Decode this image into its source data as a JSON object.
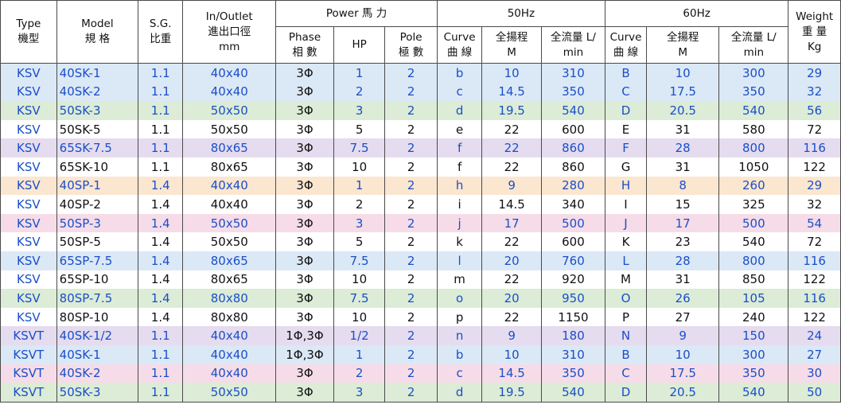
{
  "headers": {
    "type": [
      "Type",
      "機型"
    ],
    "model": [
      "Model",
      "規 格"
    ],
    "sg": [
      "S.G.",
      "比重"
    ],
    "inout": [
      "In/Outlet",
      "進出口徑",
      "mm"
    ],
    "power": "Power 馬 力",
    "hz50": "50Hz",
    "hz60": "60Hz",
    "weight": [
      "Weight",
      "重 量",
      "Kg"
    ],
    "phase": [
      "Phase",
      "相 數"
    ],
    "hp": "HP",
    "pole": [
      "Pole",
      "極 數"
    ],
    "curve": [
      "Curve",
      "曲 線"
    ],
    "head": [
      "全揚程",
      "M"
    ],
    "flow": [
      "全流量 L/",
      "min"
    ]
  },
  "rows": [
    {
      "type": "KSV",
      "model": "40SK-1",
      "sg": "1.1",
      "inout": "40x40",
      "phase": "3Φ",
      "hp": "1",
      "pole": "2",
      "c50": "b",
      "m50": "10",
      "f50": "310",
      "c60": "B",
      "m60": "10",
      "f60": "300",
      "kg": "29",
      "tint": "blue"
    },
    {
      "type": "KSV",
      "model": "40SK-2",
      "sg": "1.1",
      "inout": "40x40",
      "phase": "3Φ",
      "hp": "2",
      "pole": "2",
      "c50": "c",
      "m50": "14.5",
      "f50": "350",
      "c60": "C",
      "m60": "17.5",
      "f60": "350",
      "kg": "32",
      "tint": "blue"
    },
    {
      "type": "KSV",
      "model": "50SK-3",
      "sg": "1.1",
      "inout": "50x50",
      "phase": "3Φ",
      "hp": "3",
      "pole": "2",
      "c50": "d",
      "m50": "19.5",
      "f50": "540",
      "c60": "D",
      "m60": "20.5",
      "f60": "540",
      "kg": "56",
      "tint": "green"
    },
    {
      "type": "KSV",
      "model": "50SK-5",
      "sg": "1.1",
      "inout": "50x50",
      "phase": "3Φ",
      "hp": "5",
      "pole": "2",
      "c50": "e",
      "m50": "22",
      "f50": "600",
      "c60": "E",
      "m60": "31",
      "f60": "580",
      "kg": "72",
      "tint": "white"
    },
    {
      "type": "KSV",
      "model": "65SK-7.5",
      "sg": "1.1",
      "inout": "80x65",
      "phase": "3Φ",
      "hp": "7.5",
      "pole": "2",
      "c50": "f",
      "m50": "22",
      "f50": "860",
      "c60": "F",
      "m60": "28",
      "f60": "800",
      "kg": "116",
      "tint": "purple"
    },
    {
      "type": "KSV",
      "model": "65SK-10",
      "sg": "1.1",
      "inout": "80x65",
      "phase": "3Φ",
      "hp": "10",
      "pole": "2",
      "c50": "f",
      "m50": "22",
      "f50": "860",
      "c60": "G",
      "m60": "31",
      "f60": "1050",
      "kg": "122",
      "tint": "white"
    },
    {
      "type": "KSV",
      "model": "40SP-1",
      "sg": "1.4",
      "inout": "40x40",
      "phase": "3Φ",
      "hp": "1",
      "pole": "2",
      "c50": "h",
      "m50": "9",
      "f50": "280",
      "c60": "H",
      "m60": "8",
      "f60": "260",
      "kg": "29",
      "tint": "orange"
    },
    {
      "type": "KSV",
      "model": "40SP-2",
      "sg": "1.4",
      "inout": "40x40",
      "phase": "3Φ",
      "hp": "2",
      "pole": "2",
      "c50": "i",
      "m50": "14.5",
      "f50": "340",
      "c60": "I",
      "m60": "15",
      "f60": "325",
      "kg": "32",
      "tint": "white"
    },
    {
      "type": "KSV",
      "model": "50SP-3",
      "sg": "1.4",
      "inout": "50x50",
      "phase": "3Φ",
      "hp": "3",
      "pole": "2",
      "c50": "j",
      "m50": "17",
      "f50": "500",
      "c60": "J",
      "m60": "17",
      "f60": "500",
      "kg": "54",
      "tint": "pink"
    },
    {
      "type": "KSV",
      "model": "50SP-5",
      "sg": "1.4",
      "inout": "50x50",
      "phase": "3Φ",
      "hp": "5",
      "pole": "2",
      "c50": "k",
      "m50": "22",
      "f50": "600",
      "c60": "K",
      "m60": "23",
      "f60": "540",
      "kg": "72",
      "tint": "white"
    },
    {
      "type": "KSV",
      "model": "65SP-7.5",
      "sg": "1.4",
      "inout": "80x65",
      "phase": "3Φ",
      "hp": "7.5",
      "pole": "2",
      "c50": "l",
      "m50": "20",
      "f50": "760",
      "c60": "L",
      "m60": "28",
      "f60": "800",
      "kg": "116",
      "tint": "blue"
    },
    {
      "type": "KSV",
      "model": "65SP-10",
      "sg": "1.4",
      "inout": "80x65",
      "phase": "3Φ",
      "hp": "10",
      "pole": "2",
      "c50": "m",
      "m50": "22",
      "f50": "920",
      "c60": "M",
      "m60": "31",
      "f60": "850",
      "kg": "122",
      "tint": "white"
    },
    {
      "type": "KSV",
      "model": "80SP-7.5",
      "sg": "1.4",
      "inout": "80x80",
      "phase": "3Φ",
      "hp": "7.5",
      "pole": "2",
      "c50": "o",
      "m50": "20",
      "f50": "950",
      "c60": "O",
      "m60": "26",
      "f60": "105",
      "kg": "116",
      "tint": "green"
    },
    {
      "type": "KSV",
      "model": "80SP-10",
      "sg": "1.4",
      "inout": "80x80",
      "phase": "3Φ",
      "hp": "10",
      "pole": "2",
      "c50": "p",
      "m50": "22",
      "f50": "1150",
      "c60": "P",
      "m60": "27",
      "f60": "240",
      "kg": "122",
      "tint": "white"
    },
    {
      "type": "KSVT",
      "model": "40SK-1/2",
      "sg": "1.1",
      "inout": "40x40",
      "phase": "1Φ,3Φ",
      "hp": "1/2",
      "pole": "2",
      "c50": "n",
      "m50": "9",
      "f50": "180",
      "c60": "N",
      "m60": "9",
      "f60": "150",
      "kg": "24",
      "tint": "purple"
    },
    {
      "type": "KSVT",
      "model": "40SK-1",
      "sg": "1.1",
      "inout": "40x40",
      "phase": "1Φ,3Φ",
      "hp": "1",
      "pole": "2",
      "c50": "b",
      "m50": "10",
      "f50": "310",
      "c60": "B",
      "m60": "10",
      "f60": "300",
      "kg": "27",
      "tint": "blue"
    },
    {
      "type": "KSVT",
      "model": "40SK-2",
      "sg": "1.1",
      "inout": "40x40",
      "phase": "3Φ",
      "hp": "2",
      "pole": "2",
      "c50": "c",
      "m50": "14.5",
      "f50": "350",
      "c60": "C",
      "m60": "17.5",
      "f60": "350",
      "kg": "30",
      "tint": "pink"
    },
    {
      "type": "KSVT",
      "model": "50SK-3",
      "sg": "1.1",
      "inout": "50x50",
      "phase": "3Φ",
      "hp": "3",
      "pole": "2",
      "c50": "d",
      "m50": "19.5",
      "f50": "540",
      "c60": "D",
      "m60": "20.5",
      "f60": "540",
      "kg": "50",
      "tint": "green"
    }
  ]
}
